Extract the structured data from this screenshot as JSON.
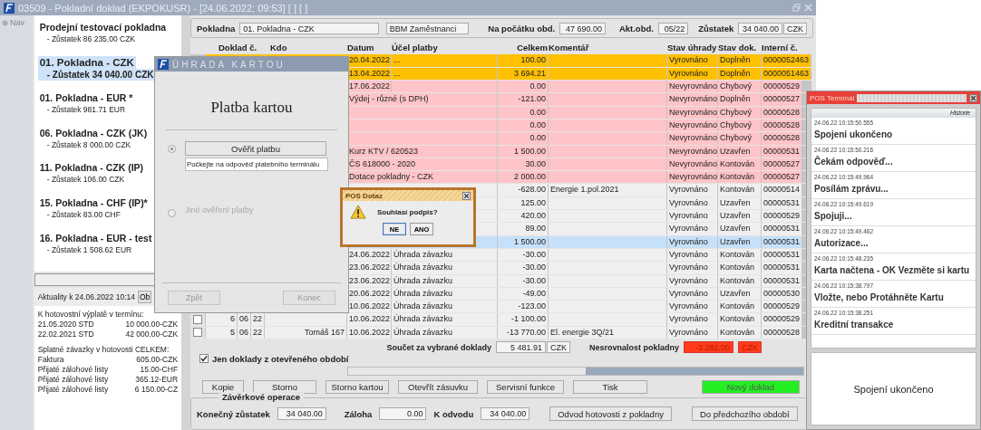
{
  "window": {
    "title": "03509 - Pokladní doklad (EKPOKUSR) - [24.06.2022; 09:53] [ ] [ ]"
  },
  "nav": {
    "label": "Nav"
  },
  "registers": [
    {
      "name": "Prodejní testovací pokladna",
      "balance": "- Zůstatek 86 235.00 CZK",
      "selected": false
    },
    {
      "name": "01. Pokladna - CZK",
      "balance": "- Zůstatek 34 040.00 CZK",
      "selected": true
    },
    {
      "name": "01. Pokladna - EUR *",
      "balance": "- Zůstatek 981.71 EUR",
      "selected": false
    },
    {
      "name": "06. Pokladna  - CZK (JK)",
      "balance": "- Zůstatek 8 000.00 CZK",
      "selected": false
    },
    {
      "name": "11. Pokladna - CZK (IP)",
      "balance": "- Zůstatek 106.00 CZK",
      "selected": false
    },
    {
      "name": "15. Pokladna - CHF (IP)*",
      "balance": "- Zůstatek 83.00 CHF",
      "selected": false
    },
    {
      "name": "16. Pokladna - EUR - test",
      "balance": "- Zůstatek 1 508.62 EUR",
      "selected": false
    }
  ],
  "news": {
    "title": "Aktuality k 24.06.2022 10:14",
    "button": "Ob",
    "groups": [
      {
        "heading": "K hotovostní výplatě v termínu:",
        "entries": [
          {
            "label": "21.05.2020 STD",
            "value": "10 000.00-CZK"
          },
          {
            "label": "22.02.2021 STD",
            "value": "42 000.00-CZK"
          }
        ]
      },
      {
        "heading": "Splatné závazky v hotovosti CELKEM:",
        "entries": [
          {
            "label": "Faktura",
            "value": "605.00-CZK"
          },
          {
            "label": "Přijaté zálohové listy",
            "value": "15.00-CHF"
          },
          {
            "label": "Přijaté zálohové listy",
            "value": "365.12-EUR"
          },
          {
            "label": "Přijaté zálohové listy",
            "value": "6 150.00-CZ"
          }
        ]
      }
    ]
  },
  "header": {
    "register_label": "Pokladna",
    "register": "01. Pokladna - CZK",
    "group": "BBM Zaměstnanci",
    "opening_label": "Na počátku obd.",
    "opening": "47 690.00",
    "period_label": "Akt.obd.",
    "period": "05/22",
    "balance_label": "Zůstatek",
    "balance": "34 040.00",
    "currency": "CZK"
  },
  "table": {
    "columns": [
      "Doklad č.",
      "Kdo",
      "Datum",
      "Účel platby",
      "Celkem",
      "Komentář",
      "Stav úhrady",
      "Stav dok.",
      "Interní č."
    ],
    "rows": [
      {
        "color": "#ffc000",
        "selected": false,
        "date": "20.04.2022",
        "purpose": "...",
        "total": "100.00",
        "payment_status": "Vyrovnáno",
        "doc_status": "Doplněn",
        "internal": "0000052463"
      },
      {
        "color": "#ffc000",
        "selected": false,
        "date": "13.04.2022",
        "purpose": "...",
        "total": "3 694.21",
        "payment_status": "Vyrovnáno",
        "doc_status": "Doplněn",
        "internal": "0000051463"
      },
      {
        "color": "#ffc4c8",
        "selected": false,
        "date": "17.06.2022",
        "total": "0.00",
        "payment_status": "Nevyrovnáno",
        "doc_status": "Chybový",
        "internal": "00000529"
      },
      {
        "color": "#ffc4c8",
        "selected": false,
        "purpose": "Výdej - různé (s DPH)",
        "total": "-121.00",
        "payment_status": "Nevyrovnáno",
        "doc_status": "Doplněn",
        "internal": "00000527"
      },
      {
        "color": "#ffc4c8",
        "selected": false,
        "total": "0.00",
        "payment_status": "Nevyrovnáno",
        "doc_status": "Chybový",
        "internal": "00000528"
      },
      {
        "color": "#ffc4c8",
        "selected": false,
        "total": "0.00",
        "payment_status": "Nevyrovnáno",
        "doc_status": "Chybový",
        "internal": "00000528"
      },
      {
        "color": "#ffc4c8",
        "selected": false,
        "total": "0.00",
        "payment_status": "Nevyrovnáno",
        "doc_status": "Chybový",
        "internal": "00000528"
      },
      {
        "color": "#ffc4c8",
        "selected": false,
        "purpose": "Kurz KTV / 620523",
        "total": "1 500.00",
        "payment_status": "Nevyrovnáno",
        "doc_status": "Uzavřen",
        "internal": "00000531"
      },
      {
        "color": "#ffc4c8",
        "selected": false,
        "purpose": "ČS 618000 - 2020",
        "total": "30.00",
        "payment_status": "Nevyrovnáno",
        "doc_status": "Kontován",
        "internal": "00000527"
      },
      {
        "color": "#ffc4c8",
        "selected": false,
        "purpose": "Dotace pokladny - CZK",
        "total": "2 000.00",
        "payment_status": "Nevyrovnáno",
        "doc_status": "Kontován",
        "internal": "00000527"
      },
      {
        "color": "#efefef",
        "selected": false,
        "total": "-628.00",
        "comment": "Energie 1.pol.2021",
        "payment_status": "Vyrovnáno",
        "doc_status": "Kontován",
        "internal": "00000514"
      },
      {
        "color": "#efefef",
        "selected": false,
        "total": "125.00",
        "payment_status": "Vyrovnáno",
        "doc_status": "Uzavřen",
        "internal": "00000531"
      },
      {
        "color": "#efefef",
        "selected": false,
        "total": "420.00",
        "payment_status": "Vyrovnáno",
        "doc_status": "Uzavřen",
        "internal": "00000529"
      },
      {
        "color": "#efefef",
        "selected": false,
        "total": "89.00",
        "payment_status": "Vyrovnáno",
        "doc_status": "Uzavřen",
        "internal": "00000531"
      },
      {
        "selected": true,
        "total": "1 500.00",
        "payment_status": "Vyrovnáno",
        "doc_status": "Uzavřen",
        "internal": "00000531"
      },
      {
        "color": "#efefef",
        "selected": false,
        "date": "24.06.2022",
        "purpose": "Úhrada závazku",
        "total": "-30.00",
        "payment_status": "Vyrovnáno",
        "doc_status": "Kontován",
        "internal": "00000531"
      },
      {
        "color": "#efefef",
        "selected": false,
        "date": "23.06.2022",
        "purpose": "Úhrada závazku",
        "total": "-30.00",
        "payment_status": "Vyrovnáno",
        "doc_status": "Kontován",
        "internal": "00000531"
      },
      {
        "color": "#efefef",
        "selected": false,
        "date": "23.06.2022",
        "purpose": "Úhrada závazku",
        "total": "-30.00",
        "payment_status": "Vyrovnáno",
        "doc_status": "Kontován",
        "internal": "00000531"
      },
      {
        "color": "#efefef",
        "selected": false,
        "date": "20.06.2022",
        "purpose": "Úhrada závazku",
        "total": "-49.00",
        "payment_status": "Vyrovnáno",
        "doc_status": "Uzavřen",
        "internal": "00000530"
      },
      {
        "color": "#efefef",
        "selected": false,
        "date": "10.06.2022",
        "purpose": "Úhrada závazku",
        "total": "-123.00",
        "payment_status": "Vyrovnáno",
        "doc_status": "Kontován",
        "internal": "00000529"
      },
      {
        "color": "#efefef",
        "selected": false,
        "checked": false,
        "number": "6",
        "month": "06",
        "year": "22",
        "date": "10.06.2022",
        "purpose": "Úhrada závazku",
        "total": "-1 100.00",
        "payment_status": "Vyrovnáno",
        "doc_status": "Kontován",
        "internal": "00000529"
      },
      {
        "color": "#efefef",
        "selected": false,
        "checked": false,
        "number": "5",
        "month": "06",
        "year": "22",
        "kdo": "Tomáš 167",
        "date": "10.06.2022",
        "purpose": "Úhrada závazku",
        "total": "-13 770.00",
        "comment": "El. energie 3Q/21",
        "payment_status": "Vyrovnáno",
        "doc_status": "Kontován",
        "internal": "00000528"
      }
    ]
  },
  "totals": {
    "sum_label": "Součet za vybrané doklady",
    "sum": "5 481.91",
    "sum_currency": "CZK",
    "diff_label": "Nesrovnalost pokladny",
    "diff": "-3 282.00",
    "diff_currency": "CZK"
  },
  "filter": {
    "label": "Jen doklady z otevřeného období",
    "checked": true
  },
  "buttons": [
    {
      "label": "Kopie",
      "kind": "normal"
    },
    {
      "label": "Storno",
      "kind": "normal"
    },
    {
      "label": "Storno kartou",
      "kind": "normal"
    },
    {
      "label": "Otevřít zásuvku",
      "kind": "normal"
    },
    {
      "label": "Servisní funkce",
      "kind": "normal"
    },
    {
      "label": "Tisk",
      "kind": "normal"
    },
    {
      "label": "Nový doklad",
      "kind": "primary"
    }
  ],
  "closing": {
    "title": "Závěrkové operace",
    "final_label": "Konečný zůstatek",
    "final": "34 040.00",
    "deposit_label": "Záloha",
    "deposit": "0.00",
    "transfer_label": "K odvodu",
    "transfer": "34 040.00",
    "buttons": [
      "Odvod hotovosti z pokladny",
      "Do předchozího období"
    ]
  },
  "card_dialog": {
    "title": "ÚHRADA KARTOU",
    "heading": "Platba kartou",
    "options": [
      {
        "selected": true,
        "button": "Ověřit platbu",
        "status": "Počkejte na odpověď platebního terminálu"
      },
      {
        "selected": false,
        "label": "Jiné ověření platby"
      }
    ],
    "buttons": [
      {
        "label": "Zpět",
        "disabled": true
      },
      {
        "label": "Konec",
        "disabled": true
      }
    ]
  },
  "pos_query": {
    "title": "POS Dotaz",
    "message": "Souhlasí podpis?",
    "buttons": [
      {
        "label": "NE",
        "focused": true
      },
      {
        "label": "ANO",
        "focused": false
      }
    ]
  },
  "pos_terminal": {
    "title": "POS Terminál",
    "history_label": "Historie",
    "events": [
      {
        "time": "24.06.22 10:15:50.555",
        "message": "Spojeni ukončeno"
      },
      {
        "time": "24.06.22 10:15:50.216",
        "message": "Čekám odpověď..."
      },
      {
        "time": "24.06.22 10:15:49.964",
        "message": "Posílám zprávu..."
      },
      {
        "time": "24.06.22 10:15:49.619",
        "message": "Spojuji..."
      },
      {
        "time": "24.06.22 10:15:49.462",
        "message": "Autorizace..."
      },
      {
        "time": "24.06.22 10:15:48.235",
        "message": "Karta načtena - OK Vezměte si kartu"
      },
      {
        "time": "24.06.22 10:15:38.797",
        "message": "Vložte, nebo Protáhněte Kartu"
      },
      {
        "time": "24.06.22 10:15:38.251",
        "message": "Kreditní transakce"
      }
    ],
    "status": "Spojení ukončeno"
  }
}
